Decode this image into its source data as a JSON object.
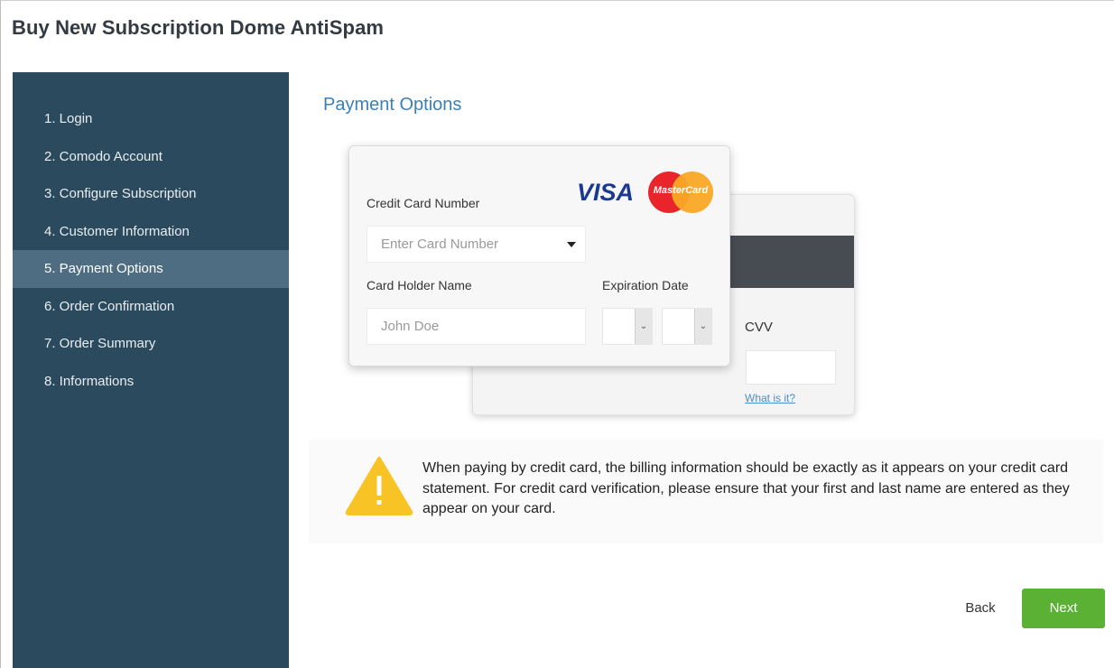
{
  "page": {
    "title": "Buy New Subscription Dome AntiSpam"
  },
  "sidebar": {
    "steps": [
      {
        "label": "1. Login"
      },
      {
        "label": "2. Comodo Account"
      },
      {
        "label": "3. Configure Subscription"
      },
      {
        "label": "4. Customer Information"
      },
      {
        "label": "5. Payment Options",
        "active": true
      },
      {
        "label": "6. Order Confirmation"
      },
      {
        "label": "7. Order Summary"
      },
      {
        "label": "8. Informations"
      }
    ]
  },
  "payment": {
    "section_title": "Payment Options",
    "card_number_label": "Credit Card Number",
    "card_number_placeholder": "Enter Card Number",
    "holder_label": "Card Holder Name",
    "holder_placeholder": "John Doe",
    "expiration_label": "Expiration Date",
    "cvv_label": "CVV",
    "cvv_help_link": "What is it?",
    "brands": {
      "visa": "VISA",
      "mastercard": "MasterCard"
    }
  },
  "notice": {
    "icon": "warning-icon",
    "text": "When paying by credit card, the billing information should be exactly as it appears on your credit card statement. For credit card verification, please ensure that your first and last name are entered as they appear on your card."
  },
  "actions": {
    "back_label": "Back",
    "next_label": "Next"
  },
  "colors": {
    "sidebar_bg": "#2b4a5e",
    "sidebar_active": "#4f6d82",
    "section_title": "#3a7fb6",
    "next_button": "#5ab133",
    "warning": "#f7c325"
  }
}
